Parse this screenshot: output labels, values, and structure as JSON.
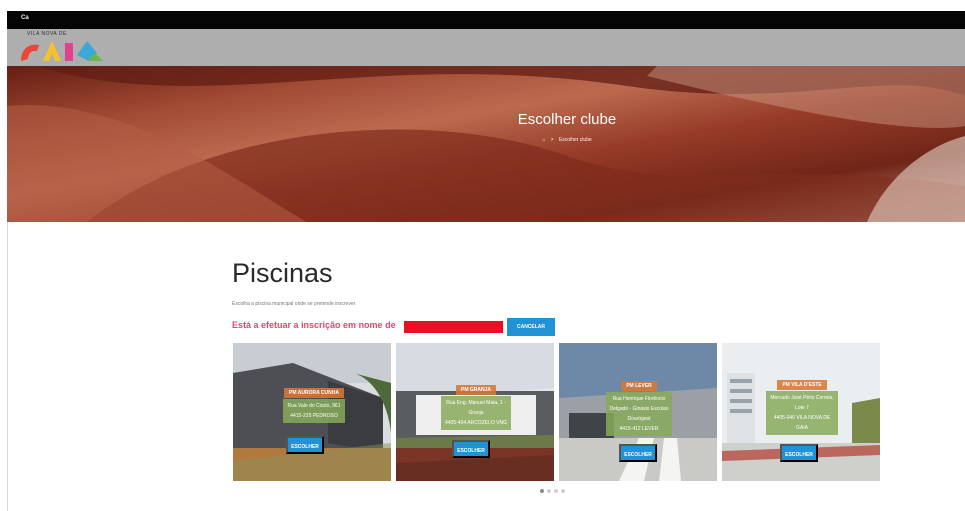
{
  "topbar": {
    "link": "Ca"
  },
  "logo": {
    "text": "VILA NOVA DE",
    "colors": [
      "#e8473a",
      "#f6c12c",
      "#3fa6dc",
      "#67b84a",
      "#e2418b"
    ]
  },
  "hero": {
    "title": "Escolher clube",
    "breadcrumb": {
      "home_icon": "home-icon",
      "separator": ">",
      "current": "Escolher clube"
    }
  },
  "main": {
    "title": "Piscinas",
    "subtitle": "Escolha a piscina municipal onde se pretende inscrever",
    "notice": "Está a efetuar a inscrição em nome de",
    "cancel_label": "CANCELAR"
  },
  "cards": [
    {
      "name": "PM AURORA CUNHA",
      "address": [
        "Rua Vale do Couto, 961",
        "4415-225 PEDROSO"
      ],
      "button": "ESCOLHER"
    },
    {
      "name": "PM GRANJA",
      "address": [
        "Rua Eng. Manuel Maia, 1 -",
        "Granja",
        "4405-404 ARCOZELO VNG"
      ],
      "button": "ESCOLHER"
    },
    {
      "name": "PM LEVER",
      "address": [
        "Rua Henrique Florêncio",
        "Delgado - Ginásio Escolas",
        "Dourógest",
        "4415-412 LEVER"
      ],
      "button": "ESCOLHER"
    },
    {
      "name": "PM VILA D'ESTE",
      "address": [
        "Mercado José Pinto Correia,",
        "Lote 7",
        "4405-040 VILA NOVA DE",
        "GAIA"
      ],
      "button": "ESCOLHER"
    }
  ],
  "carousel": {
    "dots": 4,
    "active_index": 0
  },
  "colors": {
    "accent_blue": "#1f93d6",
    "notice_pink": "#e8446b",
    "redaction_red": "#ea0f25"
  }
}
